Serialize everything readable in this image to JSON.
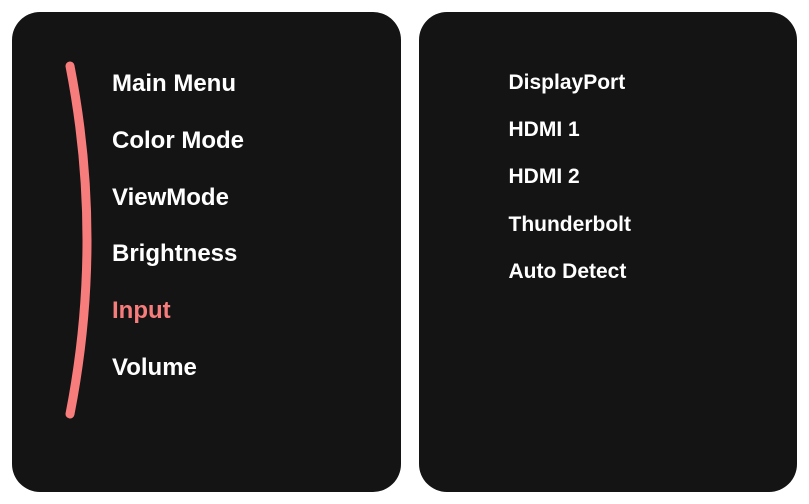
{
  "colors": {
    "background": "#141414",
    "text": "#ffffff",
    "accent": "#f77c7c"
  },
  "main_menu": {
    "selected_index": 4,
    "items": [
      {
        "label": "Main Menu"
      },
      {
        "label": "Color Mode"
      },
      {
        "label": "ViewMode"
      },
      {
        "label": "Brightness"
      },
      {
        "label": "Input"
      },
      {
        "label": "Volume"
      }
    ]
  },
  "submenu": {
    "items": [
      {
        "label": "DisplayPort"
      },
      {
        "label": "HDMI 1"
      },
      {
        "label": "HDMI 2"
      },
      {
        "label": "Thunderbolt"
      },
      {
        "label": "Auto Detect"
      }
    ]
  }
}
